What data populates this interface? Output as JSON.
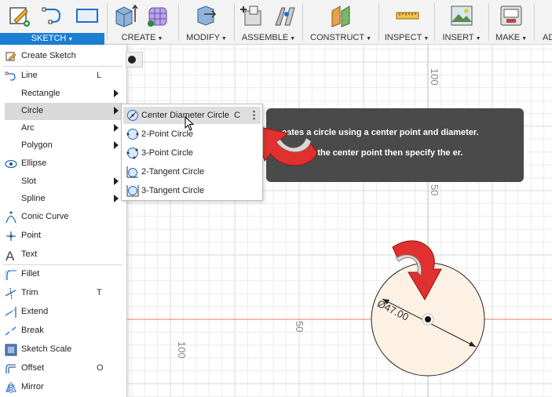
{
  "toolbar": {
    "groups": [
      {
        "label": "SKETCH",
        "active": true
      },
      {
        "label": "CREATE"
      },
      {
        "label": "MODIFY"
      },
      {
        "label": "ASSEMBLE"
      },
      {
        "label": "CONSTRUCT"
      },
      {
        "label": "INSPECT"
      },
      {
        "label": "INSERT"
      },
      {
        "label": "MAKE"
      },
      {
        "label": "AD"
      }
    ],
    "active_color": "#1a7fd4"
  },
  "sketch_menu": {
    "items": [
      {
        "label": "Create Sketch",
        "icon": "create-sketch-icon"
      },
      {
        "label": "Line",
        "shortcut": "L",
        "icon": "line-icon"
      },
      {
        "label": "Rectangle",
        "submenu": true
      },
      {
        "label": "Circle",
        "submenu": true,
        "highlighted": true
      },
      {
        "label": "Arc",
        "submenu": true
      },
      {
        "label": "Polygon",
        "submenu": true
      },
      {
        "label": "Ellipse",
        "icon": "ellipse-icon"
      },
      {
        "label": "Slot",
        "submenu": true
      },
      {
        "label": "Spline",
        "submenu": true
      },
      {
        "label": "Conic Curve",
        "icon": "conic-curve-icon"
      },
      {
        "label": "Point",
        "icon": "point-icon"
      },
      {
        "label": "Text",
        "icon": "text-icon"
      },
      {
        "label": "Fillet",
        "icon": "fillet-icon"
      },
      {
        "label": "Trim",
        "shortcut": "T",
        "icon": "trim-icon"
      },
      {
        "label": "Extend",
        "icon": "extend-icon"
      },
      {
        "label": "Break",
        "icon": "break-icon"
      },
      {
        "label": "Sketch Scale",
        "icon": "sketch-scale-icon"
      },
      {
        "label": "Offset",
        "shortcut": "O",
        "icon": "offset-icon"
      },
      {
        "label": "Mirror",
        "icon": "mirror-icon"
      }
    ]
  },
  "circle_submenu": {
    "items": [
      {
        "label": "Center Diameter Circle",
        "shortcut": "C",
        "more": "⋮",
        "highlighted": true
      },
      {
        "label": "2-Point Circle"
      },
      {
        "label": "3-Point Circle"
      },
      {
        "label": "2-Tangent Circle"
      },
      {
        "label": "3-Tangent Circle"
      }
    ]
  },
  "tooltip": {
    "line1": "eates a circle using a center point and diameter.",
    "line2": "o define the center point then specify the er."
  },
  "canvas": {
    "axis_labels": {
      "v100": "100",
      "v50": "50",
      "h100": "100",
      "h50": "50"
    },
    "dimension": "Ø47.00",
    "fill_color": "#fdf1e4",
    "axis_color": "#f07070",
    "arrow_color": "#e03030"
  }
}
